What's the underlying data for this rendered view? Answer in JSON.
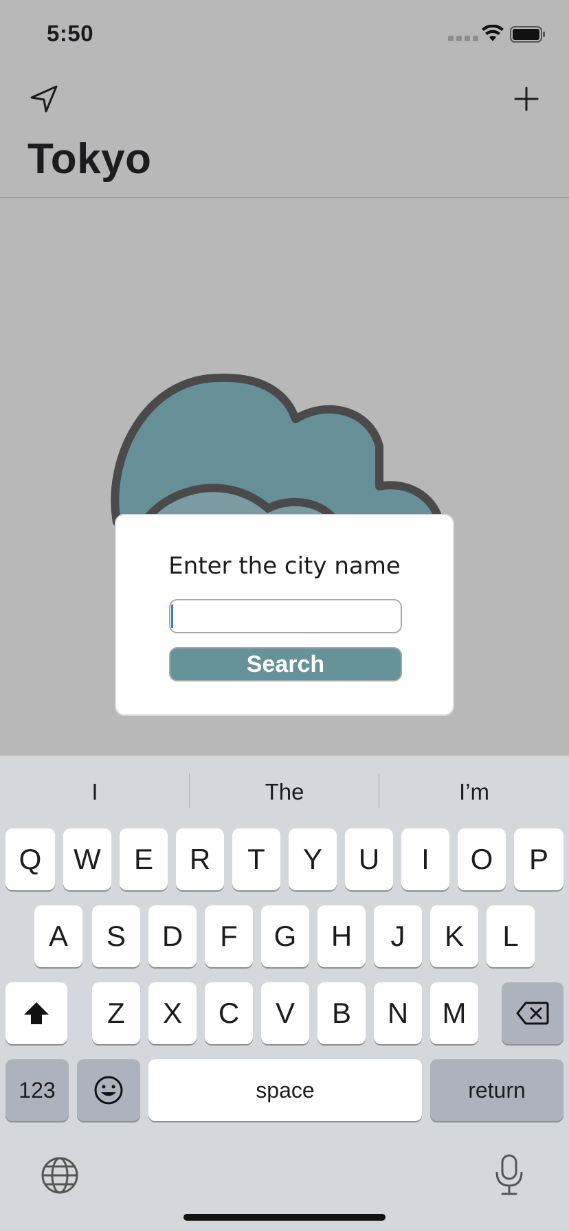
{
  "status_bar": {
    "time": "5:50"
  },
  "nav": {
    "title": "Tokyo",
    "left_icon": "location-arrow-icon",
    "right_icon": "plus-icon"
  },
  "dialog": {
    "title": "Enter the city name",
    "input_value": "",
    "input_placeholder": "",
    "button_label": "Search"
  },
  "keyboard": {
    "suggestions": [
      "I",
      "The",
      "I’m"
    ],
    "row1": [
      "Q",
      "W",
      "E",
      "R",
      "T",
      "Y",
      "U",
      "I",
      "O",
      "P"
    ],
    "row2": [
      "A",
      "S",
      "D",
      "F",
      "G",
      "H",
      "J",
      "K",
      "L"
    ],
    "row3": [
      "Z",
      "X",
      "C",
      "V",
      "B",
      "N",
      "M"
    ],
    "numbers_label": "123",
    "space_label": "space",
    "return_label": "return"
  },
  "colors": {
    "accent": "#66929a",
    "dim_background": "#b8b8b8",
    "keyboard_background": "#d4d7dc",
    "caret": "#3478f6"
  }
}
